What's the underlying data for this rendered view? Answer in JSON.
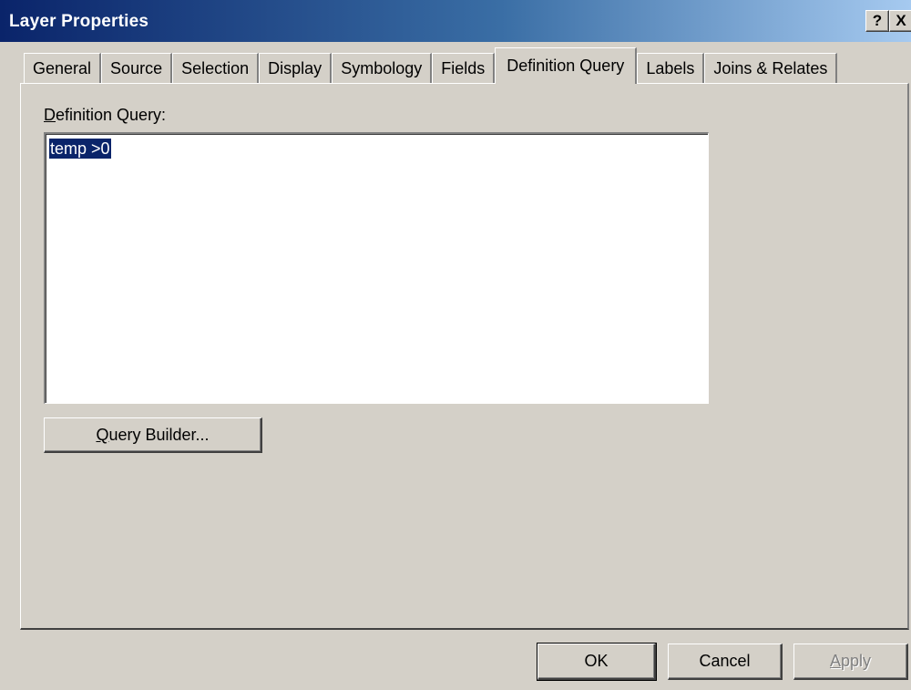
{
  "window": {
    "title": "Layer Properties",
    "help_button": "?",
    "close_button": "X"
  },
  "tabs": [
    {
      "label": "General"
    },
    {
      "label": "Source"
    },
    {
      "label": "Selection"
    },
    {
      "label": "Display"
    },
    {
      "label": "Symbology"
    },
    {
      "label": "Fields"
    },
    {
      "label": "Definition Query",
      "active": true
    },
    {
      "label": "Labels"
    },
    {
      "label": "Joins & Relates"
    }
  ],
  "definition_query": {
    "label_mnemonic": "D",
    "label_rest": "efinition Query:",
    "value": "temp >0",
    "query_builder_mnemonic": "Q",
    "query_builder_rest": "uery Builder..."
  },
  "footer": {
    "ok_label": "OK",
    "cancel_label": "Cancel",
    "apply_mnemonic": "A",
    "apply_rest": "pply"
  }
}
